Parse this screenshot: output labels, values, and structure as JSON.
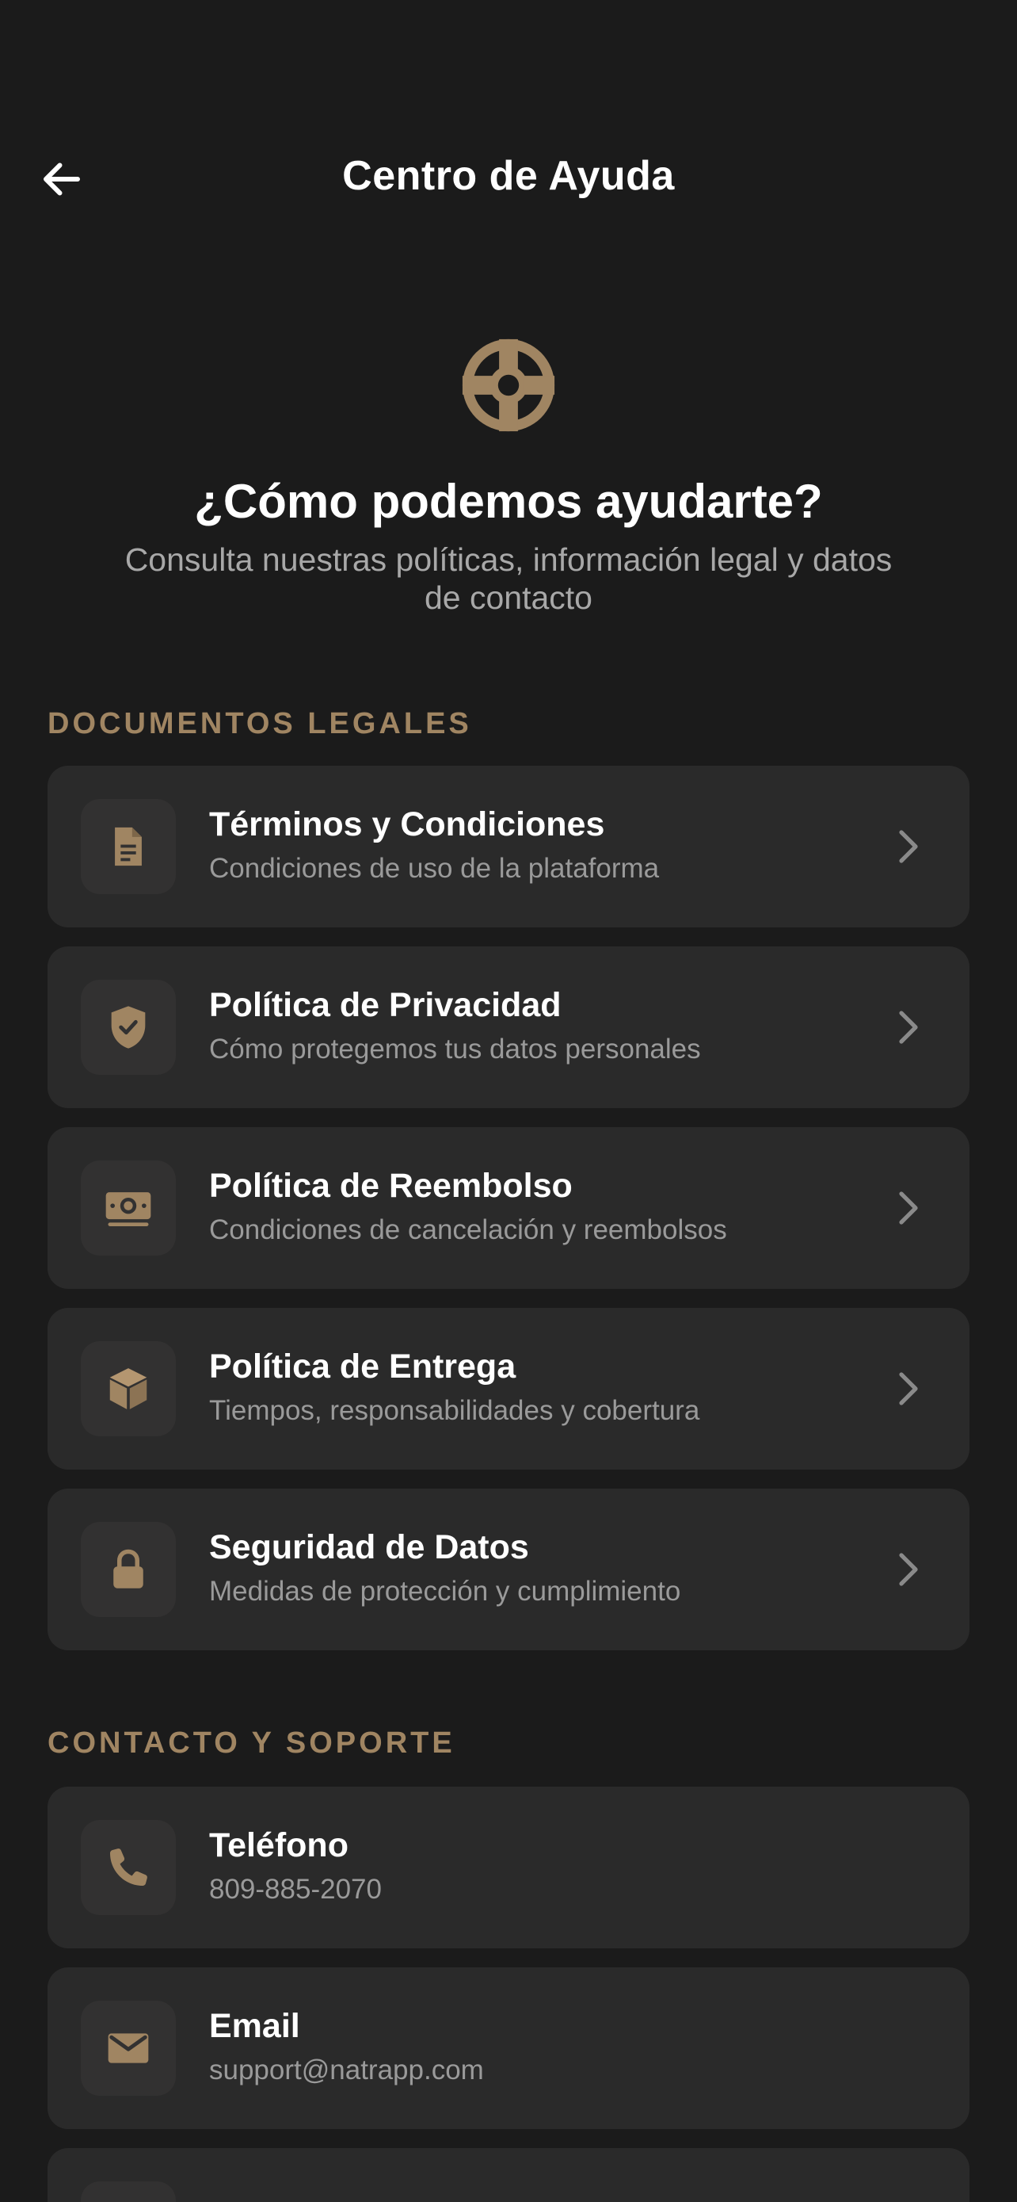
{
  "header": {
    "title": "Centro de Ayuda",
    "back_icon": "arrow-left-icon"
  },
  "hero": {
    "icon": "lifebuoy-icon",
    "title": "¿Cómo podemos ayudarte?",
    "subtitle": "Consulta nuestras políticas, información legal y datos de contacto"
  },
  "legal_section": {
    "label": "DOCUMENTOS LEGALES",
    "items": [
      {
        "title": "Términos y Condiciones",
        "subtitle": "Condiciones de uso de la plataforma",
        "icon": "document-icon"
      },
      {
        "title": "Política de Privacidad",
        "subtitle": "Cómo protegemos tus datos personales",
        "icon": "shield-check-icon"
      },
      {
        "title": "Política de Reembolso",
        "subtitle": "Condiciones de cancelación y reembolsos",
        "icon": "money-icon"
      },
      {
        "title": "Política de Entrega",
        "subtitle": "Tiempos, responsabilidades y cobertura",
        "icon": "package-icon"
      },
      {
        "title": "Seguridad de Datos",
        "subtitle": "Medidas de protección y cumplimiento",
        "icon": "lock-icon"
      }
    ]
  },
  "contact_section": {
    "label": "CONTACTO Y SOPORTE",
    "items": [
      {
        "title": "Teléfono",
        "subtitle": "809-885-2070",
        "icon": "phone-icon"
      },
      {
        "title": "Email",
        "subtitle": "support@natrapp.com",
        "icon": "mail-icon"
      }
    ]
  },
  "colors": {
    "background": "#1b1b1b",
    "card": "#2a2a2a",
    "accent": "#a08562",
    "text": "#ffffff",
    "muted": "#9a9a9a"
  }
}
